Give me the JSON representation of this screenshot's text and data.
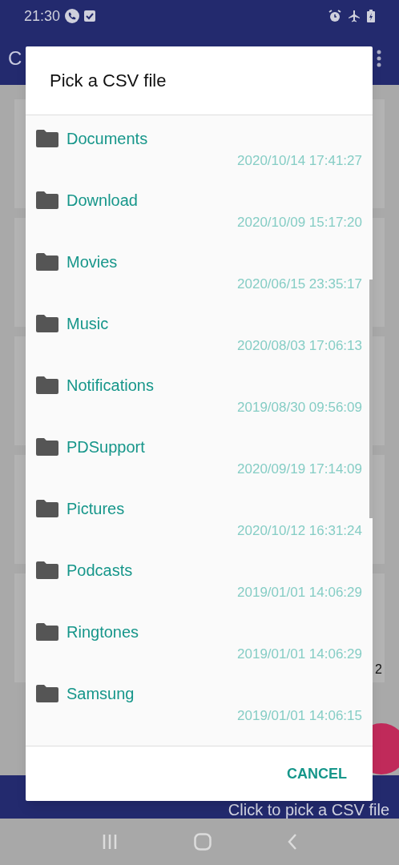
{
  "status_bar": {
    "time": "21:30"
  },
  "app_bar": {
    "title": "C"
  },
  "background": {
    "card_text": "2",
    "bottom_bar_text": "Click to pick a CSV file"
  },
  "dialog": {
    "title": "Pick a CSV file",
    "items": [
      {
        "name": "Documents",
        "date": "2020/10/14 17:41:27"
      },
      {
        "name": "Download",
        "date": "2020/10/09 15:17:20"
      },
      {
        "name": "Movies",
        "date": "2020/06/15 23:35:17"
      },
      {
        "name": "Music",
        "date": "2020/08/03 17:06:13"
      },
      {
        "name": "Notifications",
        "date": "2019/08/30 09:56:09"
      },
      {
        "name": "PDSupport",
        "date": "2020/09/19 17:14:09"
      },
      {
        "name": "Pictures",
        "date": "2020/10/12 16:31:24"
      },
      {
        "name": "Podcasts",
        "date": "2019/01/01 14:06:29"
      },
      {
        "name": "Ringtones",
        "date": "2019/01/01 14:06:29"
      },
      {
        "name": "Samsung",
        "date": "2019/01/01 14:06:15"
      }
    ],
    "buttons": [
      "CANCEL"
    ]
  }
}
